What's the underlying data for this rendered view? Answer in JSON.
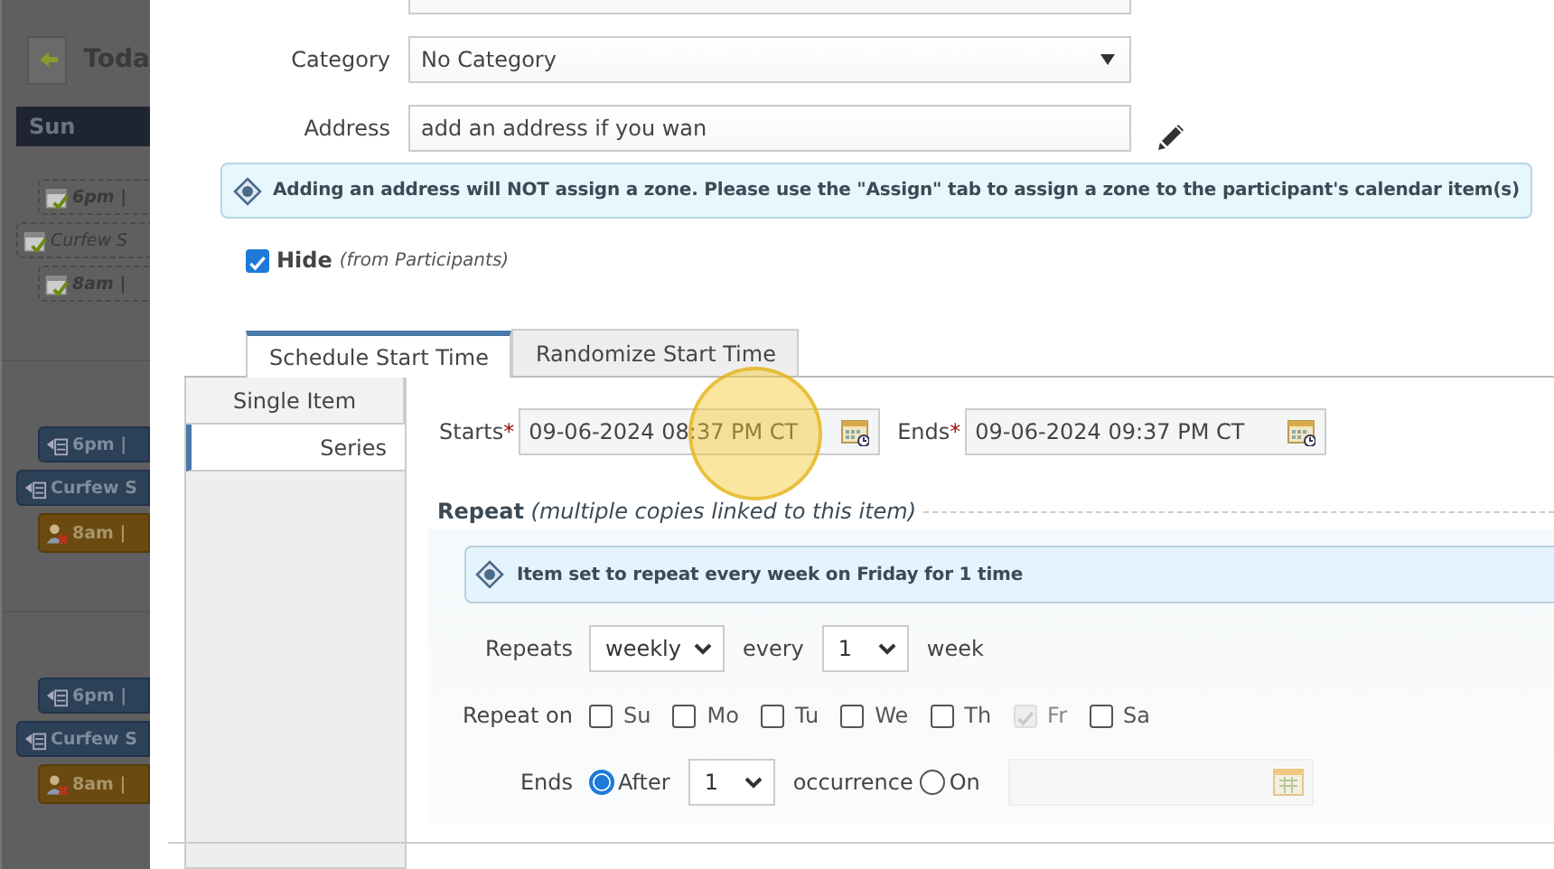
{
  "calendar": {
    "today_button": "Toda",
    "day_header": "Sun",
    "events": [
      {
        "kind": "dashed",
        "text": "6pm |"
      },
      {
        "kind": "wide-dashed",
        "text": "Curfew S"
      },
      {
        "kind": "dashed",
        "text": "8am |"
      },
      {
        "kind": "gap"
      },
      {
        "kind": "blue",
        "text": "6pm |"
      },
      {
        "kind": "wide-blue",
        "text": "Curfew S"
      },
      {
        "kind": "orange",
        "text": "8am |"
      },
      {
        "kind": "gap"
      },
      {
        "kind": "blue",
        "text": "6pm |"
      },
      {
        "kind": "wide-blue",
        "text": "Curfew S"
      },
      {
        "kind": "orange",
        "text": "8am |"
      }
    ]
  },
  "form": {
    "fields": [
      {
        "kind": "text"
      },
      {
        "kind": "select",
        "label": "Category",
        "value": "No Category"
      },
      {
        "kind": "text",
        "label": "Address",
        "value": "add an address if you wan",
        "editable": true
      }
    ],
    "notice": "Adding an address will NOT assign a zone. Please use the \"Assign\" tab to assign a zone to the participant's calendar item(s)",
    "hide": {
      "label": "Hide",
      "note": "(from Participants)",
      "checked": true
    }
  },
  "tabs": [
    {
      "label": "Schedule Start Time",
      "selected": true
    },
    {
      "label": "Randomize Start Time",
      "selected": false
    }
  ],
  "side_tabs": [
    {
      "label": "Single Item",
      "selected": false
    },
    {
      "label": "Series",
      "selected": true
    }
  ],
  "times": [
    {
      "label": "Starts",
      "required_mark": "*",
      "value": "09-06-2024 08:37 PM CT"
    },
    {
      "label": "Ends",
      "required_mark": "*",
      "value": "09-06-2024 09:37 PM CT"
    }
  ],
  "repeat": {
    "legend": "Repeat",
    "note": "(multiple copies linked to this item)",
    "summary": "Item set to repeat every week on Friday for 1 time",
    "repeats_label": "Repeats",
    "frequency": "weekly",
    "every_label": "every",
    "interval": "1",
    "unit": "week",
    "repeat_on_label": "Repeat on",
    "days": [
      {
        "label": "Su",
        "checked": false,
        "disabled": false
      },
      {
        "label": "Mo",
        "checked": false,
        "disabled": false
      },
      {
        "label": "Tu",
        "checked": false,
        "disabled": false
      },
      {
        "label": "We",
        "checked": false,
        "disabled": false
      },
      {
        "label": "Th",
        "checked": false,
        "disabled": false
      },
      {
        "label": "Fr",
        "checked": true,
        "disabled": true
      },
      {
        "label": "Sa",
        "checked": false,
        "disabled": false
      }
    ],
    "ends_label": "Ends",
    "after": {
      "label": "After",
      "selected": true
    },
    "occurrences": "1",
    "occurrence_label": "occurrence",
    "on": {
      "label": "On",
      "selected": false
    }
  }
}
